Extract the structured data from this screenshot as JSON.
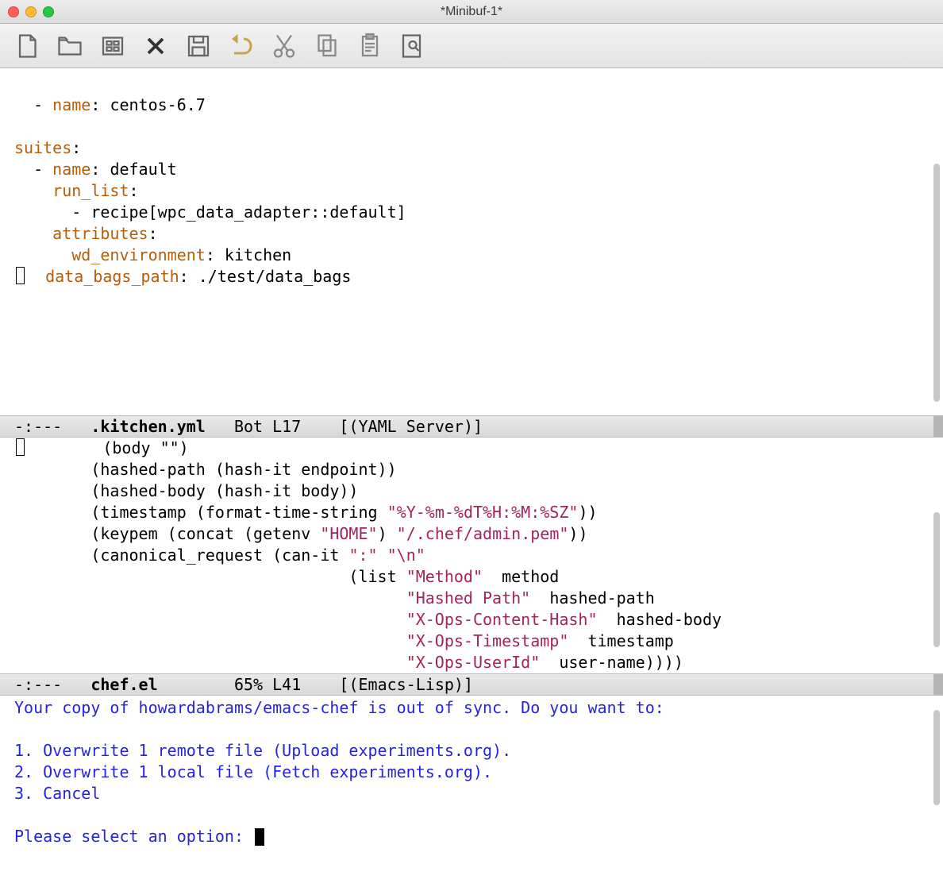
{
  "window": {
    "title": "*Minibuf-1*"
  },
  "toolbar_icons": [
    "new-file",
    "open-file",
    "dired",
    "close",
    "save",
    "undo",
    "cut",
    "copy",
    "paste",
    "search"
  ],
  "yaml": {
    "l1_key": "name",
    "l1_val": "centos-6.7",
    "l2_key": "suites",
    "l3_key": "name",
    "l3_val": "default",
    "l4_key": "run_list",
    "l5_val": "recipe[wpc_data_adapter::default]",
    "l6_key": "attributes",
    "l7_key": "wd_environment",
    "l7_val": "kitchen",
    "l8_key": "data_bags_path",
    "l8_val": "./test/data_bags"
  },
  "modeline1": {
    "left": "-:--- ",
    "file": ".kitchen.yml",
    "rest": "   Bot L17    [(YAML Server)]"
  },
  "lisp": {
    "l1": "        (body \"\")",
    "l2": "        (hashed-path (hash-it endpoint))",
    "l3": "        (hashed-body (hash-it body))",
    "l4a": "        (timestamp (format-time-string ",
    "l4s": "\"%Y-%m-%dT%H:%M:%SZ\"",
    "l4b": "))",
    "l5a": "        (keypem (concat (getenv ",
    "l5s1": "\"HOME\"",
    "l5m": ") ",
    "l5s2": "\"/.chef/admin.pem\"",
    "l5b": "))",
    "l6a": "        (canonical_request (can-it ",
    "l6s1": "\":\"",
    "l6m": " ",
    "l6s2": "\"\\n\"",
    "l7a": "                                   (list ",
    "l7s": "\"Method\"",
    "l7b": "  method",
    "l8a": "                                         ",
    "l8s": "\"Hashed Path\"",
    "l8b": "  hashed-path",
    "l9s": "\"X-Ops-Content-Hash\"",
    "l9b": "  hashed-body",
    "l10s": "\"X-Ops-Timestamp\"",
    "l10b": "  timestamp",
    "l11s": "\"X-Ops-UserId\"",
    "l11b": "  user-name))))"
  },
  "modeline2": {
    "left": "-:--- ",
    "file": "chef.el",
    "rest": "        65% L41    [(Emacs-Lisp)]"
  },
  "minibuf": {
    "l1": "Your copy of howardabrams/emacs-chef is out of sync. Do you want to:",
    "l2": "",
    "l3": "1. Overwrite 1 remote file (Upload experiments.org).",
    "l4": "2. Overwrite 1 local file (Fetch experiments.org).",
    "l5": "3. Cancel",
    "l6": "",
    "l7": "Please select an option: "
  }
}
